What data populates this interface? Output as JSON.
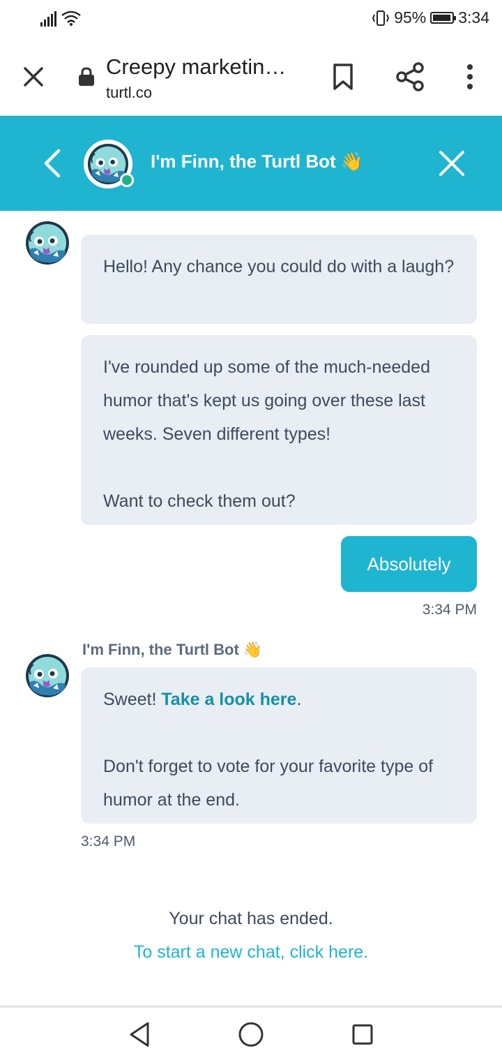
{
  "status_bar": {
    "battery": "95%",
    "time": "3:34",
    "battery_level": 0.95
  },
  "browser": {
    "page_title": "Creepy marketin…",
    "host": "turtl.co"
  },
  "chat_header": {
    "title": "I'm Finn, the Turtl Bot 👋"
  },
  "messages": {
    "bot1": {
      "text": "Hello! Any chance you could do with a laugh?"
    },
    "bot2": {
      "line1": "I've rounded up some of the much-needed humor that's kept us going over these last weeks. Seven different types!",
      "line2": "Want to check them out?"
    },
    "user1": {
      "text": "Absolutely",
      "time": "3:34 PM"
    },
    "bot3": {
      "sender": "I'm Finn, the Turtl Bot 👋",
      "prefix": "Sweet! ",
      "link": "Take a look here",
      "suffix": ".",
      "line2": "Don't forget to vote for your favorite type of humor at the end.",
      "time": "3:34 PM"
    }
  },
  "chat_end": {
    "text": "Your chat has ended.",
    "link": "To start a new chat, click here."
  },
  "colors": {
    "accent": "#1fb5d1",
    "bubble": "#e9eef5",
    "online": "#1db08a"
  }
}
